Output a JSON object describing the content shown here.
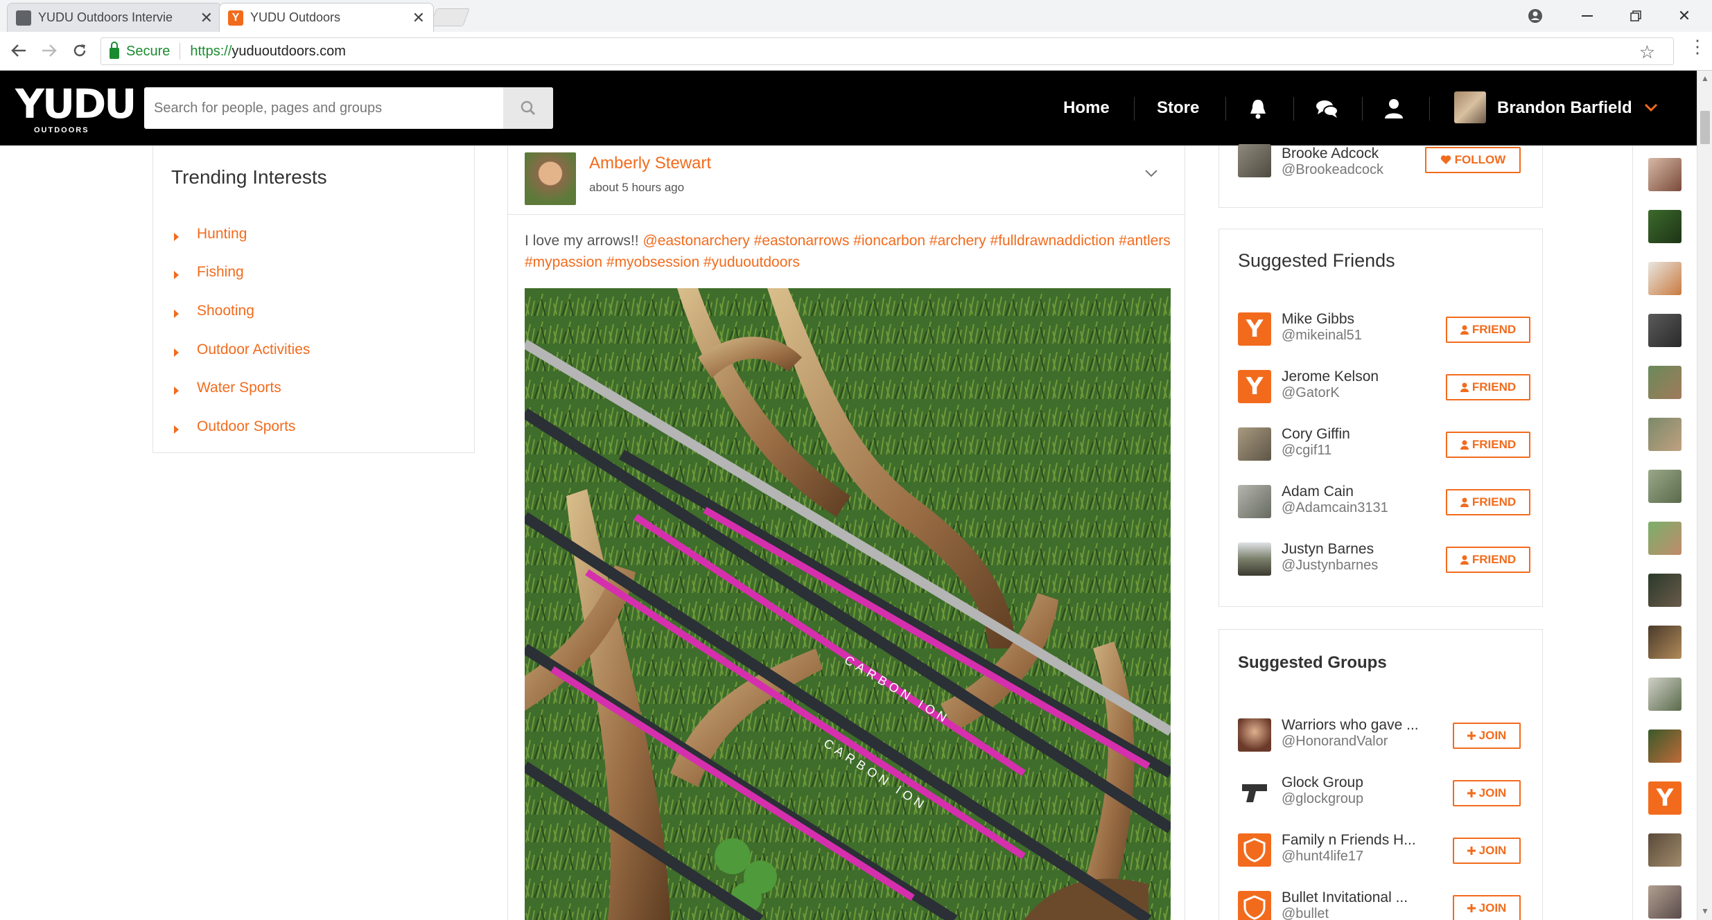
{
  "browser": {
    "tabs": [
      {
        "title": "YUDU Outdoors Intervie",
        "active": false
      },
      {
        "title": "YUDU Outdoors",
        "active": true
      }
    ],
    "secure_label": "Secure",
    "url_scheme": "https://",
    "url_host": "yuduoutdoors.com"
  },
  "header": {
    "logo": "YUDU",
    "logo_sub": "OUTDOORS",
    "search_placeholder": "Search for people, pages and groups",
    "nav": {
      "home": "Home",
      "store": "Store"
    },
    "user_name": "Brandon Barfield"
  },
  "trending": {
    "title": "Trending Interests",
    "items": [
      "Hunting",
      "Fishing",
      "Shooting",
      "Outdoor Activities",
      "Water Sports",
      "Outdoor Sports"
    ]
  },
  "post": {
    "author": "Amberly Stewart",
    "time": "about 5 hours ago",
    "text_plain": "I love my arrows!! ",
    "text_tags": "@eastonarchery #eastonarrows #ioncarbon #archery #fulldrawnaddiction #antlers #mypassion #myobsession #yuduoutdoors",
    "image_text": "CARBON ION"
  },
  "follow_suggestion": {
    "name": "Brooke Adcock",
    "handle": "@Brookeadcock",
    "button": "FOLLOW"
  },
  "suggested_friends": {
    "title": "Suggested Friends",
    "button": "FRIEND",
    "people": [
      {
        "name": "Mike Gibbs",
        "handle": "@mikeinal51",
        "avatar": "y"
      },
      {
        "name": "Jerome Kelson",
        "handle": "@GatorK",
        "avatar": "y"
      },
      {
        "name": "Cory Giffin",
        "handle": "@cgif11",
        "avatar": "photo"
      },
      {
        "name": "Adam Cain",
        "handle": "@Adamcain3131",
        "avatar": "photo"
      },
      {
        "name": "Justyn Barnes",
        "handle": "@Justynbarnes",
        "avatar": "photo"
      }
    ]
  },
  "suggested_groups": {
    "title": "Suggested Groups",
    "button": "JOIN",
    "groups": [
      {
        "name": "Warriors who gave ...",
        "handle": "@HonorandValor"
      },
      {
        "name": "Glock Group",
        "handle": "@glockgroup"
      },
      {
        "name": "Family n Friends H...",
        "handle": "@hunt4life17"
      },
      {
        "name": "Bullet Invitational ...",
        "handle": "@bullet"
      }
    ]
  },
  "online_strip_logo": "Y",
  "colors": {
    "brand": "#f26b1d",
    "header_bg": "#000000",
    "secure": "#1a8c2f"
  },
  "icons": [
    "bell-icon",
    "chat-icon",
    "user-icon",
    "search-icon",
    "chevron-down-icon",
    "heart-icon",
    "person-icon",
    "plus-icon"
  ]
}
